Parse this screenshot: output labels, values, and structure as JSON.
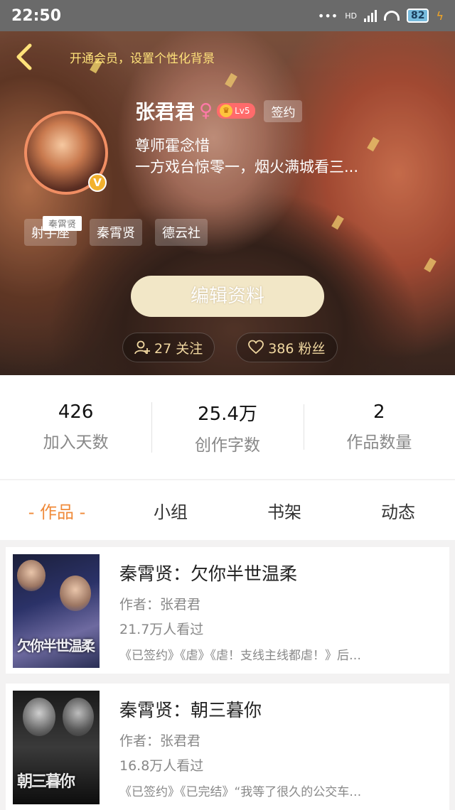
{
  "status_bar": {
    "time": "22:50",
    "hd": "HD",
    "battery": "82"
  },
  "header": {
    "vip_tip": "开通会员，设置个性化背景"
  },
  "profile": {
    "name": "张君君",
    "gender_symbol": "♀",
    "level": "Lv5",
    "signed_badge": "签约",
    "bio_line1": "尊师霍念惜",
    "bio_line2": "一方戏台惊零一，烟火满城看三...",
    "avatar_tag": "秦霄贤",
    "verified_symbol": "V",
    "tags": [
      "射手座",
      "秦霄贤",
      "德云社"
    ],
    "edit_button": "编辑资料",
    "following": "27 关注",
    "followers": "386 粉丝"
  },
  "stats": [
    {
      "value": "426",
      "label": "加入天数"
    },
    {
      "value": "25.4万",
      "label": "创作字数"
    },
    {
      "value": "2",
      "label": "作品数量"
    }
  ],
  "tabs": [
    "- 作品 -",
    "小组",
    "书架",
    "动态"
  ],
  "works": [
    {
      "title": "秦霄贤：欠你半世温柔",
      "author": "作者：张君君",
      "views": "21.7万人看过",
      "desc": "《已签约》《虐》《虐！支线主线都虐！》后…",
      "cover_text": "欠你半世温柔"
    },
    {
      "title": "秦霄贤：朝三暮你",
      "author": "作者：张君君",
      "views": "16.8万人看过",
      "desc": "《已签约》《已完结》“我等了很久的公交车…",
      "cover_text": "朝三暮你"
    }
  ],
  "colors": {
    "accent": "#f08b3b",
    "vip": "#ffe27a",
    "level": "#ff6b6b"
  }
}
